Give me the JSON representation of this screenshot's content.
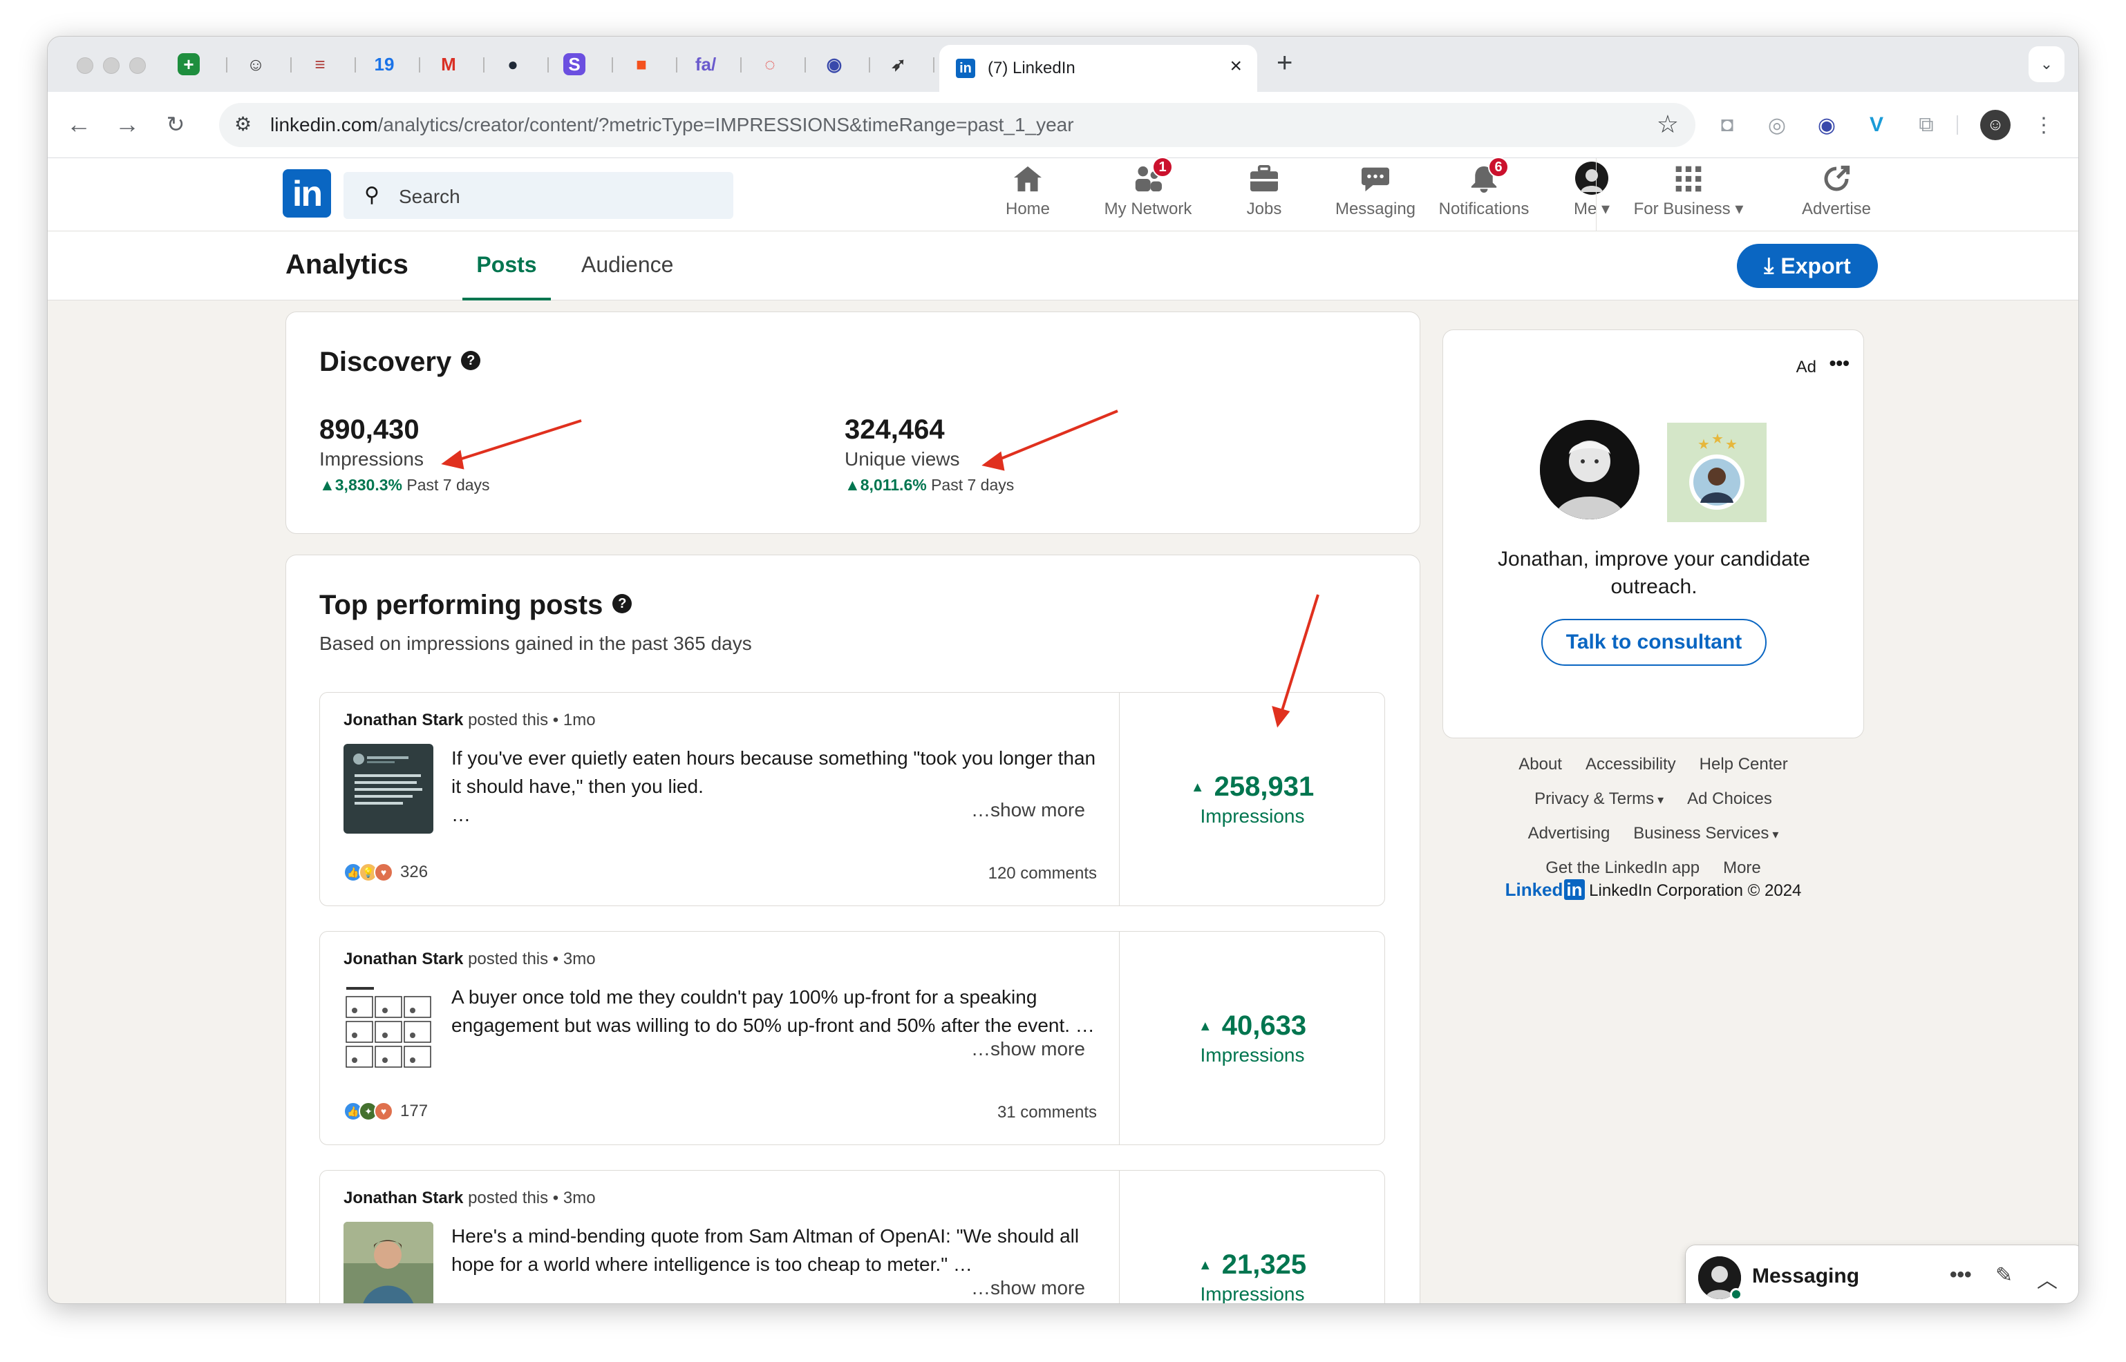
{
  "browser": {
    "active_tab": {
      "title": "(7) LinkedIn",
      "favicon": "in"
    },
    "pinned_tabs": [
      {
        "icon": "sheets-icon",
        "glyph": "+",
        "color": "#1e8e3e",
        "bg": "#1e8e3e"
      },
      {
        "icon": "robot-icon",
        "glyph": "☺",
        "color": "#333333",
        "bg": "transparent"
      },
      {
        "icon": "stack-icon",
        "glyph": "≡",
        "color": "#b0413e",
        "bg": "transparent"
      },
      {
        "icon": "calendar-icon",
        "glyph": "19",
        "color": "#1a73e8",
        "bg": "transparent"
      },
      {
        "icon": "gmail-icon",
        "glyph": "M",
        "color": "#d93025",
        "bg": "transparent"
      },
      {
        "icon": "dark-circle-icon",
        "glyph": "●",
        "color": "#1f2937",
        "bg": "transparent"
      },
      {
        "icon": "s-app-icon",
        "glyph": "S",
        "color": "#ffffff",
        "bg": "#6b4fe0"
      },
      {
        "icon": "orange-square-icon",
        "glyph": "■",
        "color": "#f4511e",
        "bg": "transparent"
      },
      {
        "icon": "fa-icon",
        "glyph": "fa/",
        "color": "#6a5acd",
        "bg": "transparent"
      },
      {
        "icon": "red-ring-icon",
        "glyph": "◌",
        "color": "#e53935",
        "bg": "transparent"
      },
      {
        "icon": "blue-orb-icon",
        "glyph": "◉",
        "color": "#3949ab",
        "bg": "transparent"
      },
      {
        "icon": "bird-icon",
        "glyph": "➶",
        "color": "#333333",
        "bg": "transparent"
      }
    ],
    "url_host": "linkedin.com",
    "url_path": "/analytics/creator/content/?metricType=IMPRESSIONS&timeRange=past_1_year"
  },
  "nav": {
    "search_placeholder": "Search",
    "items": [
      {
        "label": "Home",
        "icon": "home-icon"
      },
      {
        "label": "My Network",
        "icon": "network-icon",
        "badge": "1"
      },
      {
        "label": "Jobs",
        "icon": "briefcase-icon"
      },
      {
        "label": "Messaging",
        "icon": "messaging-icon"
      },
      {
        "label": "Notifications",
        "icon": "bell-icon",
        "badge": "6"
      },
      {
        "label": "Me",
        "icon": "avatar"
      },
      {
        "label": "For Business",
        "icon": "grid-icon"
      },
      {
        "label": "Advertise",
        "icon": "advertise-icon"
      }
    ]
  },
  "subnav": {
    "title": "Analytics",
    "tabs": [
      "Posts",
      "Audience"
    ],
    "active_tab": "Posts",
    "export_label": "Export"
  },
  "discovery": {
    "title": "Discovery",
    "metrics": [
      {
        "value": "890,430",
        "label": "Impressions",
        "change": "3,830.3%",
        "period": "Past 7 days"
      },
      {
        "value": "324,464",
        "label": "Unique views",
        "change": "8,011.6%",
        "period": "Past 7 days"
      }
    ]
  },
  "top_posts": {
    "title": "Top performing posts",
    "subtitle": "Based on impressions gained in the past 365 days",
    "posted_this": "posted this",
    "show_more": "…show more",
    "impressions_label": "Impressions",
    "posts": [
      {
        "author": "Jonathan Stark",
        "age": "1mo",
        "text": "If you've ever quietly eaten hours because something \"took you longer than it should have,\" then you lied.\n…",
        "reactions": "326",
        "comments": "120 comments",
        "impressions": "258,931"
      },
      {
        "author": "Jonathan Stark",
        "age": "3mo",
        "text": "A buyer once told me they couldn't pay 100% up-front for a speaking engagement but was willing to do 50% up-front and 50% after the event. …",
        "reactions": "177",
        "comments": "31 comments",
        "impressions": "40,633"
      },
      {
        "author": "Jonathan Stark",
        "age": "3mo",
        "text": "Here's a mind-bending quote from Sam Altman of OpenAI: \"We should all hope for a world where intelligence is too cheap to meter.\" …",
        "reactions": "",
        "comments": "",
        "impressions": "21,325"
      }
    ]
  },
  "ad": {
    "label": "Ad",
    "text": "Jonathan, improve your candidate outreach.",
    "cta": "Talk to consultant"
  },
  "footer": {
    "rows": [
      [
        "About",
        "Accessibility",
        "Help Center"
      ],
      [
        "Privacy & Terms",
        "Ad Choices"
      ],
      [
        "Advertising",
        "Business Services"
      ],
      [
        "Get the LinkedIn app",
        "More"
      ]
    ],
    "brand_word": "Linked",
    "brand_in": "in",
    "copyright": "LinkedIn Corporation © 2024"
  },
  "messaging_dock": {
    "label": "Messaging"
  },
  "colors": {
    "linkedin_blue": "#0a66c2",
    "positive_green": "#01754f",
    "badge_red": "#cb112d",
    "annotation_red": "#e0301e"
  }
}
